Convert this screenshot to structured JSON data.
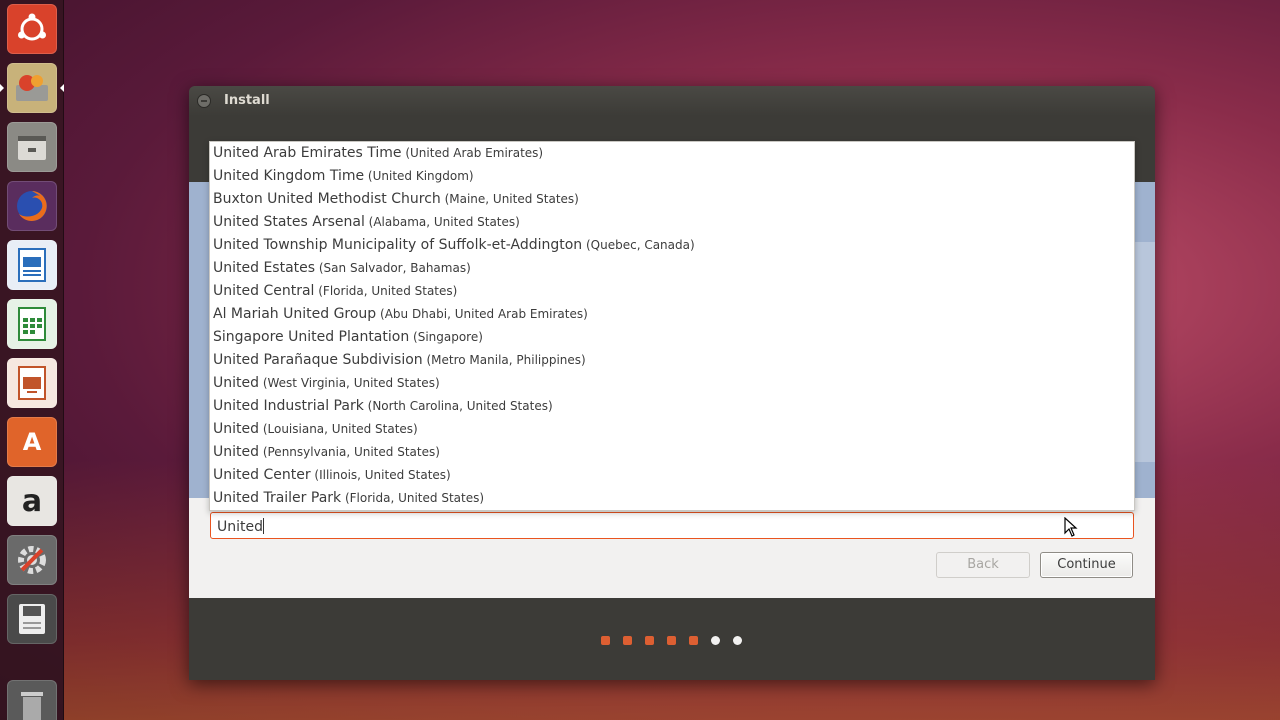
{
  "window": {
    "title": "Install"
  },
  "timezone_search": {
    "value": "United"
  },
  "buttons": {
    "back": "Back",
    "continue": "Continue"
  },
  "suggestions": [
    {
      "name": "United Arab Emirates Time",
      "region": "(United Arab Emirates)"
    },
    {
      "name": "United Kingdom Time",
      "region": "(United Kingdom)"
    },
    {
      "name": "Buxton United Methodist Church",
      "region": "(Maine, United States)"
    },
    {
      "name": "United States Arsenal",
      "region": "(Alabama, United States)"
    },
    {
      "name": "United Township Municipality of Suffolk-et-Addington",
      "region": "(Quebec, Canada)"
    },
    {
      "name": "United Estates",
      "region": "(San Salvador, Bahamas)"
    },
    {
      "name": "United Central",
      "region": "(Florida, United States)"
    },
    {
      "name": "Al Mariah United Group",
      "region": "(Abu Dhabi, United Arab Emirates)"
    },
    {
      "name": "Singapore United Plantation",
      "region": "(Singapore)"
    },
    {
      "name": "United Parañaque Subdivision",
      "region": "(Metro Manila, Philippines)"
    },
    {
      "name": "United",
      "region": "(West Virginia, United States)"
    },
    {
      "name": "United Industrial Park",
      "region": "(North Carolina, United States)"
    },
    {
      "name": "United",
      "region": "(Louisiana, United States)"
    },
    {
      "name": "United",
      "region": "(Pennsylvania, United States)"
    },
    {
      "name": "United Center",
      "region": "(Illinois, United States)"
    },
    {
      "name": "United Trailer Park",
      "region": "(Florida, United States)"
    }
  ],
  "progress": {
    "steps_total": 7,
    "steps_done": 5
  },
  "launcher": [
    {
      "icon": "ubuntu-logo-icon",
      "color": "#d9422b"
    },
    {
      "icon": "installer-icon",
      "color": "#c8b27a"
    },
    {
      "icon": "file-manager-icon",
      "color": "#8b8a85"
    },
    {
      "icon": "firefox-icon",
      "color": "#e66000"
    },
    {
      "icon": "writer-icon",
      "color": "#2a6ebb"
    },
    {
      "icon": "calc-icon",
      "color": "#2e8b3a"
    },
    {
      "icon": "impress-icon",
      "color": "#c1542a"
    },
    {
      "icon": "software-center-icon",
      "color": "#e0642a"
    },
    {
      "icon": "amazon-icon",
      "color": "#e8e6e2"
    },
    {
      "icon": "system-settings-icon",
      "color": "#6a6a6a"
    },
    {
      "icon": "drive-icon",
      "color": "#4a4a4a"
    },
    {
      "icon": "trash-icon",
      "color": "#5a5a5a"
    }
  ],
  "colors": {
    "accent": "#e95420",
    "panel": "#3c3b37"
  }
}
